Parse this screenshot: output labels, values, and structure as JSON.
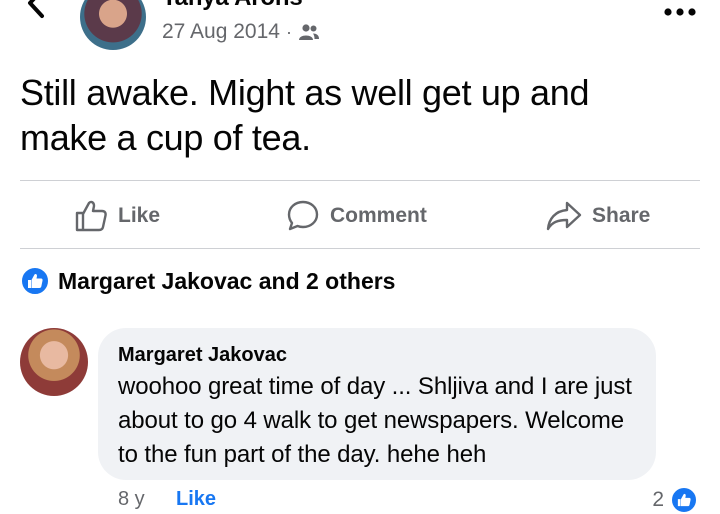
{
  "header": {
    "author": "Tanya Arons",
    "date": "27 Aug 2014",
    "separator": "·",
    "audience_icon": "friends-icon"
  },
  "post": {
    "text": "Still awake.  Might as well get up and make a cup of tea."
  },
  "actions": {
    "like": "Like",
    "comment": "Comment",
    "share": "Share"
  },
  "reactions": {
    "summary": "Margaret Jakovac and 2 others"
  },
  "comment": {
    "author": "Margaret Jakovac",
    "text": "woohoo great time of day  ... Shljiva and I are just about to go 4 walk to get newspapers. Welcome to the fun part of the day. hehe heh",
    "time": "8 y",
    "like_label": "Like",
    "reaction_count": "2"
  },
  "colors": {
    "accent": "#1877f2",
    "secondary_text": "#65676b",
    "bubble": "#f0f2f5",
    "divider": "#ced0d4"
  }
}
